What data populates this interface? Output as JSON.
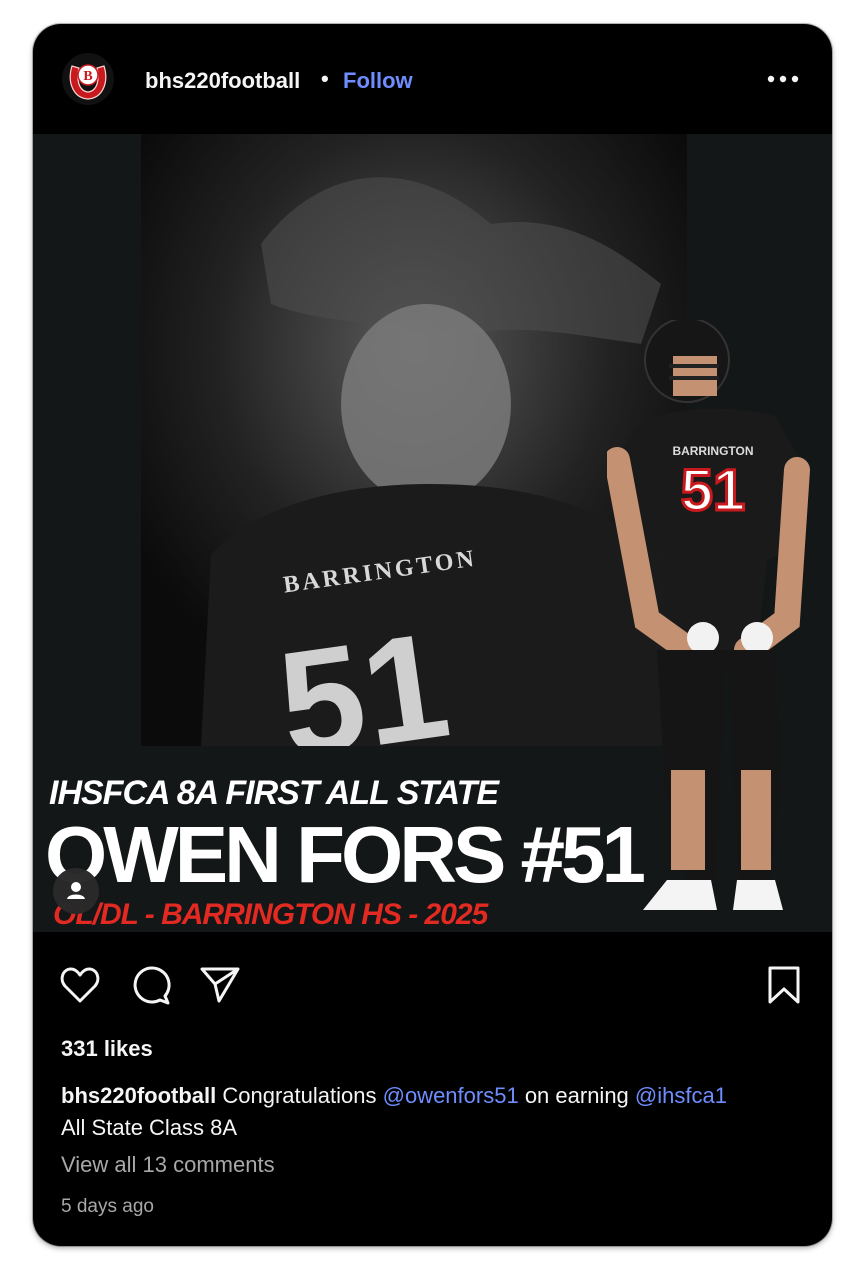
{
  "post": {
    "username": "bhs220football",
    "separator": "•",
    "follow_label": "Follow",
    "avatar_letter": "B"
  },
  "media": {
    "headline": "IHSFCA 8A FIRST ALL STATE",
    "player_name": "OWEN FORS #51",
    "position_line": "OL/DL - BARRINGTON HS - 2025",
    "jersey_team": "BARRINGTON",
    "jersey_number": "51"
  },
  "engagement": {
    "likes": "331 likes"
  },
  "caption": {
    "username": "bhs220football",
    "text1": "Congratulations",
    "mention1": "@owenfors51",
    "text2": "on earning",
    "mention2": "@ihsfca1",
    "text3": "All State Class 8A"
  },
  "comments_link": "View all 13 comments",
  "timestamp": "5 days ago",
  "icons": [
    "horseshoe-logo-icon",
    "more-options-icon",
    "heart-icon",
    "comment-icon",
    "share-icon",
    "bookmark-icon",
    "tagged-user-icon"
  ],
  "colors": {
    "card_bg": "#000000",
    "link_blue": "#6f8dff",
    "accent_red": "#e22a22",
    "muted_text": "#a8a8a8"
  }
}
